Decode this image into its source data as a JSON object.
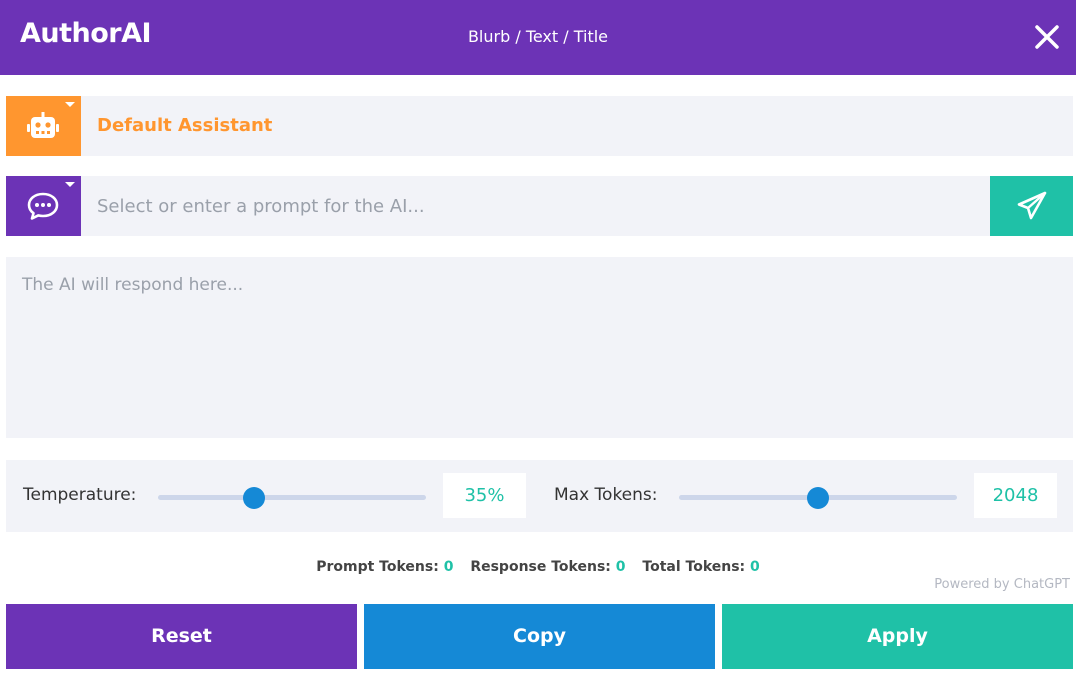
{
  "header": {
    "brand": "AuthorAI",
    "breadcrumb": "Blurb / Text / Title"
  },
  "assistant": {
    "name": "Default Assistant"
  },
  "prompt": {
    "placeholder": "Select or enter a prompt for the AI..."
  },
  "response": {
    "placeholder": "The AI will respond here..."
  },
  "settings": {
    "temperature": {
      "label": "Temperature:",
      "value": "35%",
      "level": 0.36
    },
    "max_tokens": {
      "label": "Max Tokens:",
      "value": "2048",
      "level": 0.5
    }
  },
  "tokens": {
    "prompt_label": "Prompt Tokens:",
    "prompt_value": "0",
    "response_label": "Response Tokens:",
    "response_value": "0",
    "total_label": "Total Tokens:",
    "total_value": "0"
  },
  "powered_by": "Powered by ChatGPT",
  "actions": {
    "reset": "Reset",
    "copy": "Copy",
    "apply": "Apply"
  },
  "icons": {
    "close": "close-icon",
    "assistant": "robot-icon",
    "prompt": "chat-bubble-icon",
    "send": "paper-plane-icon"
  },
  "colors": {
    "brand_purple": "#6c33b6",
    "orange": "#ff962f",
    "teal": "#1fc1a7",
    "blue": "#1589d6",
    "panel": "#f2f3f8"
  }
}
